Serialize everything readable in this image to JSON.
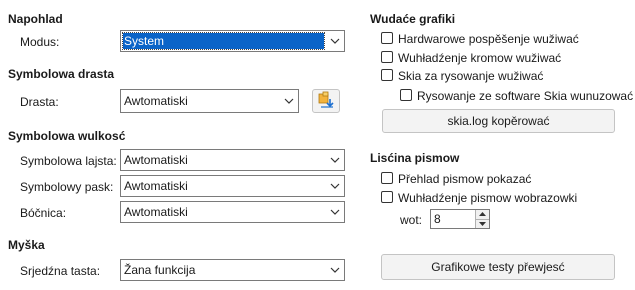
{
  "left": {
    "look": {
      "heading": "Napohlad",
      "mode_label": "Modus:",
      "mode_value": "System"
    },
    "icon_theme": {
      "heading": "Symbolowa drasta",
      "theme_label": "Drasta:",
      "theme_value": "Awtomatiski",
      "add_theme_icon": "add-extension-icon"
    },
    "icon_size": {
      "heading": "Symbolowa wulkosć",
      "toolbar_label": "Symbolowa lajsta:",
      "toolbar_value": "Awtomatiski",
      "notebookbar_label": "Symbolowy pask:",
      "notebookbar_value": "Awtomatiski",
      "sidebar_label": "Bóčnica:",
      "sidebar_value": "Awtomatiski"
    },
    "mouse": {
      "heading": "Myška",
      "middle_button_label": "Srjedźna tasta:",
      "middle_button_value": "Žana funkcija"
    }
  },
  "right": {
    "graphics": {
      "heading": "Wudaće grafiki",
      "hw_accel_label": "Hardwarowe pospěšenje wužiwać",
      "hw_accel_checked": false,
      "antialias_label": "Wuhładźenje kromow wužiwać",
      "antialias_checked": false,
      "skia_label": "Skia za rysowanje wužiwać",
      "skia_checked": false,
      "skia_software_label": "Rysowanje ze software Skia wunuzować",
      "skia_software_checked": false,
      "copy_log_button": "skia.log kopěrować"
    },
    "font_lists": {
      "heading": "Lisćina pismow",
      "preview_label": "Přehlad pismow pokazać",
      "preview_checked": false,
      "screen_aa_label": "Wuhładźenje pismow wobrazowki",
      "screen_aa_checked": false,
      "from_label": "wot:",
      "from_value": "8"
    },
    "run_tests_button": "Grafikowe testy přewjesć"
  },
  "colors": {
    "selection": "#0a64c8",
    "border": "#7a7a7a"
  }
}
